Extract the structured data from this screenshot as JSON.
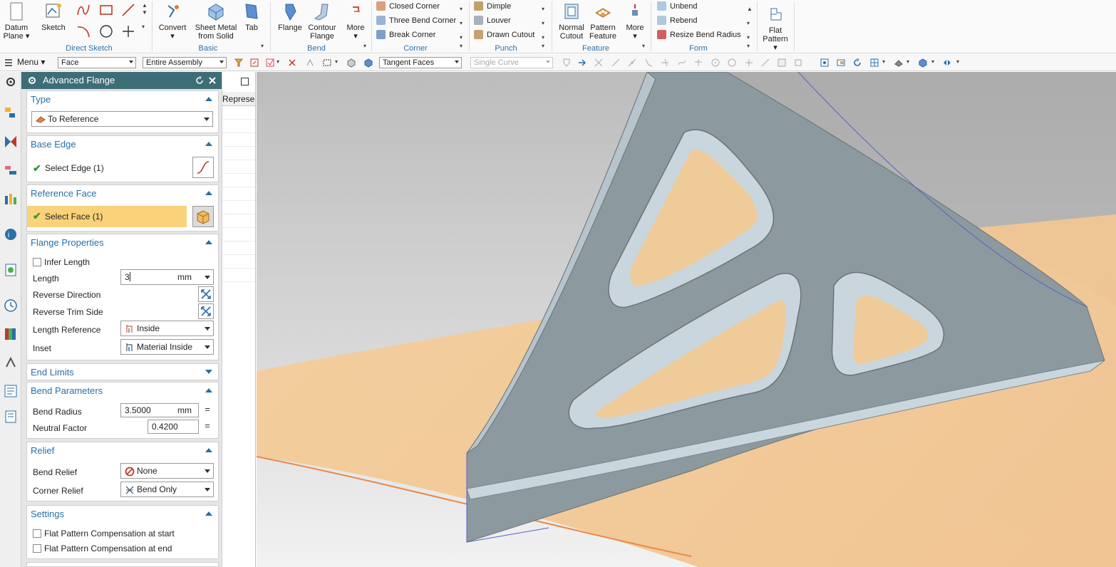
{
  "ribbon": {
    "datum_plane": "Datum Plane",
    "sketch": "Sketch",
    "direct_sketch": "Direct Sketch",
    "convert": "Convert",
    "sheet_metal_from_solid": "Sheet Metal from Solid",
    "tab": "Tab",
    "basic": "Basic",
    "flange": "Flange",
    "contour_flange": "Contour Flange",
    "more_bend": "More",
    "bend": "Bend",
    "closed_corner": "Closed Corner",
    "three_bend_corner": "Three Bend Corner",
    "break_corner": "Break Corner",
    "corner": "Corner",
    "dimple": "Dimple",
    "louver": "Louver",
    "drawn_cutout": "Drawn Cutout",
    "punch": "Punch",
    "normal_cutout": "Normal Cutout",
    "pattern_feature": "Pattern Feature",
    "more_feature": "More",
    "feature": "Feature",
    "unbend": "Unbend",
    "rebend": "Rebend",
    "resize_bend_radius": "Resize Bend Radius",
    "form": "Form",
    "flat_pattern": "Flat Pattern"
  },
  "toolbar": {
    "menu": "Menu",
    "filter_type": "Face",
    "filter_scope": "Entire Assembly",
    "face_rule": "Tangent Faces",
    "curve_rule": "Single Curve"
  },
  "dialog": {
    "title": "Advanced Flange",
    "type": {
      "header": "Type",
      "value": "To Reference"
    },
    "base_edge": {
      "header": "Base Edge",
      "select": "Select Edge (1)"
    },
    "reference_face": {
      "header": "Reference Face",
      "select": "Select Face (1)"
    },
    "flange_properties": {
      "header": "Flange Properties",
      "infer_length": "Infer Length",
      "length_label": "Length",
      "length_value": "3",
      "length_unit": "mm",
      "reverse_direction": "Reverse Direction",
      "reverse_trim_side": "Reverse Trim Side",
      "length_reference_label": "Length Reference",
      "length_reference_value": "Inside",
      "inset_label": "Inset",
      "inset_value": "Material Inside"
    },
    "end_limits": {
      "header": "End Limits"
    },
    "bend_parameters": {
      "header": "Bend Parameters",
      "bend_radius_label": "Bend Radius",
      "bend_radius_value": "3.5000",
      "bend_radius_unit": "mm",
      "neutral_factor_label": "Neutral Factor",
      "neutral_factor_value": "0.4200"
    },
    "relief": {
      "header": "Relief",
      "bend_relief_label": "Bend Relief",
      "bend_relief_value": "None",
      "corner_relief_label": "Corner Relief",
      "corner_relief_value": "Bend Only"
    },
    "settings": {
      "header": "Settings",
      "fp_start": "Flat Pattern Compensation at start",
      "fp_end": "Flat Pattern Compensation at end"
    }
  },
  "side_panel": {
    "header": "Represe"
  },
  "colors": {
    "dialog_header": "#3d6e78",
    "accent": "#2a6fa8",
    "selected_row": "#f9d27a",
    "part": "#8b99a0",
    "plane": "#f3c58c"
  }
}
